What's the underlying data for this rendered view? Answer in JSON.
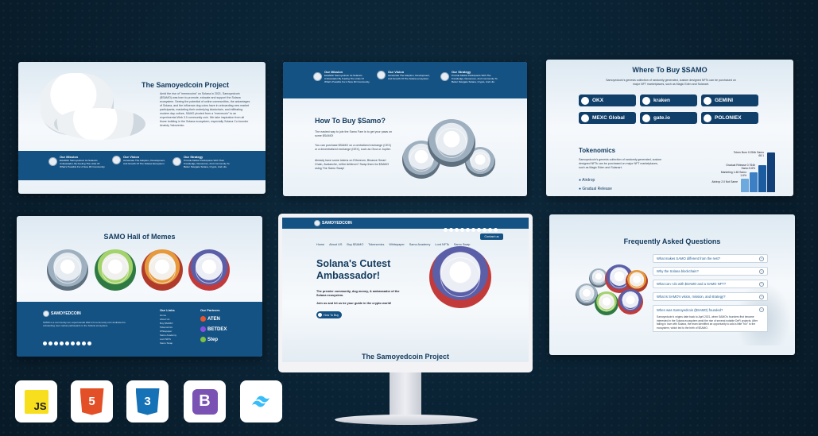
{
  "brand": "SAMOYEDCOIN",
  "card1": {
    "title": "The Samoyedcoin Project",
    "body": "Amid the rise of \"memecoins\" on Solana in 2021, Samoyedcoin ($SAMO) was born to promote, educate and support the Solana ecosystem. Seeing the potential of online communities, the advantages of Solana, and the influence dog coins have in onboarding new market participants, marketing their underlying blockchain, and infiltrating modern day culture, SAMO pivoted from a \"memecoin\" to an experimental Web 3.0 community coin. We take inspiration from all those building in the Solana ecosystem, especially Solana Co-founder Anatoly Yakovenko.",
    "items": [
      {
        "t": "Our Mission",
        "d": "Establish Samoyedcoin As Solana's Ambassador, By Fueling The Links Of What's Possible For A New 3D Community."
      },
      {
        "t": "Our Vision",
        "d": "Accelerate The Adoption, Development, And Growth Of The Solana Ecosystem."
      },
      {
        "t": "Our Strategy",
        "d": "Provide Market Participants With Their Knowledge, Resources, And Community To Better Navigate Solana, Crypto, And Life."
      }
    ]
  },
  "card2": {
    "items": [
      {
        "t": "Our Mission",
        "d": "Establish Samoyedcoin As Solana's Ambassador By Fueling The Links Of What's Possible For A New 3D Community."
      },
      {
        "t": "Our Vision",
        "d": "Accelerate The Adoption, Development, And Growth Of The Solana ecosystem."
      },
      {
        "t": "Our Strategy",
        "d": "Provide Market Participants With The Knowledge, Resources, And Community To Better Navigate Solana, Crypto, And Life."
      }
    ],
    "title": "How To Buy $Samo?",
    "p1": "The easiest way to join the Samo Fam is to get your paws on some $SAMO!",
    "p2": "You can purchase $SAMO on a centralized exchange (CEX) or a decentralized exchange (DEX), such as Orca or Jupiter.",
    "p3": "Already have some tokens on Ethereum, Binance Smart Chain, Avalanche, or/the Arbitrum? Swap them for $SAMO using The Samo Swap!"
  },
  "card3": {
    "title": "Where To Buy $SAMO",
    "sub": "Samoyedcoin's genesis collection of randomly generated, custom designed NFTs can be purchased on major NFT marketplaces, such as Magic Eden and Solanart.",
    "exchanges": [
      "OKX",
      "kraken",
      "GEMINI",
      "MEXC Global",
      "gate.io",
      "POLONIEX"
    ],
    "tok_title": "Tokenomics",
    "tok_body": "Samoyedcoin's genesis collection of randomly generated, custom designed NFTs can be purchased on major NFT marketplaces, such as Magic Eden and Solanart.",
    "list": [
      "Airdrop",
      "Gradual Release"
    ],
    "bars": [
      {
        "l": "Airdrop 2.0 Not Same",
        "v": 0.3
      },
      {
        "l": "Marketing 1.48 Samo 1.6%",
        "v": 0.45
      },
      {
        "l": "Gradual Release 0.764b Samo 5.8%",
        "v": 0.62
      },
      {
        "l": "Token Burn 0.254b Samo 68.1",
        "v": 0.9
      }
    ]
  },
  "card4": {
    "title": "SAMO Hall of Memes",
    "footer_text": "SAMO is a community-run experimental Web 3.0 community coin dedicated to onboarding new market participants to the Solana ecosystem.",
    "links_title": "Our Links",
    "links": [
      "Home",
      "About Us",
      "Buy $SAMO",
      "Tokenomics",
      "Whitepaper",
      "Samo Academy",
      "Lord NFTs",
      "Samo Swap"
    ],
    "partners_title": "Our Partners",
    "partners": [
      "ATEN",
      "BETDEX",
      "Step"
    ]
  },
  "monitor": {
    "nav": [
      "Home",
      "About US",
      "Buy $SAMO",
      "Tokenomics",
      "Whitepaper",
      "Samo Academy",
      "Lord NFTs",
      "Samo Swap"
    ],
    "contact": "Contact us",
    "hero_title": "Solana's Cutest Ambassador!",
    "hero_sub": "The premier community, dog money, & ambassador of the Solana ecosystem.",
    "hero_join": "Join us and let us be your guide in the crypto world!",
    "hero_btn": "How To Buy",
    "section_title": "The Samoyedcoin Project"
  },
  "card6": {
    "title": "Frequently Asked Questions",
    "faqs": [
      "What makes SAMO different from the rest?",
      "Why the Solana blockchain?",
      "What can I do with $SAMO and a SAMO NFT?",
      "What is SAMO's vision, mission, and strategy?",
      "When was Samoyedcoin ($SAMO) founded?"
    ],
    "answer": "Samoyedcoin's origins date back to April 2021, when SAMO's founders first became interested in the Solana ecosystem amid the rise of several notable DeFi projects. After falling in love with Solana, the team identified an opportunity to add a little \"fun\" to the ecosystem, which led to the birth of $SAMO."
  },
  "tech_logos": [
    "JS",
    "HTML5",
    "CSS3",
    "Bootstrap",
    "Tailwind"
  ]
}
